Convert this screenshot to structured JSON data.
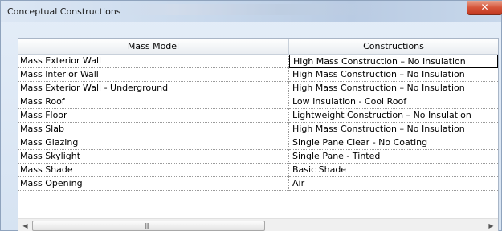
{
  "window": {
    "title": "Conceptual Constructions",
    "close_glyph": "✕"
  },
  "table": {
    "headers": [
      "Mass Model",
      "Constructions"
    ],
    "rows": [
      {
        "model": "Mass Exterior Wall",
        "construction": "High Mass Construction – No Insulation"
      },
      {
        "model": "Mass Interior Wall",
        "construction": "High Mass Construction – No Insulation"
      },
      {
        "model": "Mass Exterior Wall - Underground",
        "construction": "High Mass Construction – No Insulation"
      },
      {
        "model": "Mass Roof",
        "construction": "Low Insulation - Cool Roof"
      },
      {
        "model": "Mass Floor",
        "construction": "Lightweight Construction – No Insulation"
      },
      {
        "model": "Mass Slab",
        "construction": "High Mass Construction – No Insulation"
      },
      {
        "model": "Mass Glazing",
        "construction": "Single Pane Clear - No Coating"
      },
      {
        "model": "Mass Skylight",
        "construction": "Single Pane - Tinted"
      },
      {
        "model": "Mass Shade",
        "construction": "Basic Shade"
      },
      {
        "model": "Mass Opening",
        "construction": "Air"
      }
    ]
  },
  "scrollbar": {
    "left_glyph": "◀",
    "right_glyph": "▶",
    "grip_glyph": "|||"
  },
  "colors": {
    "close_button": "#c2381f",
    "title_bar": "#c9d9ec"
  }
}
